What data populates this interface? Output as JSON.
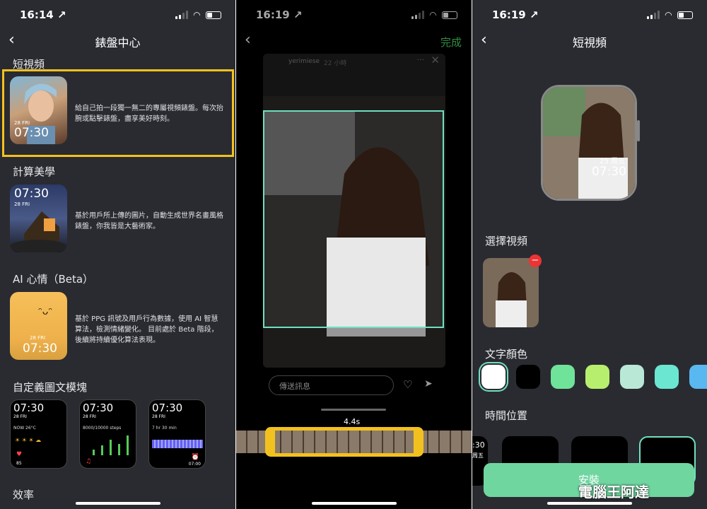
{
  "panel1": {
    "status_time": "16:14 ↗",
    "title": "錶盤中心",
    "sections": [
      {
        "title": "短視頻",
        "desc": "給自己拍一段獨一無二的專屬視頻錶盤。每次抬腕或點擊錶盤，盡享美好時刻。",
        "time": "07:30",
        "date": "28 FRI"
      },
      {
        "title": "計算美學",
        "desc": "基於用戶所上傳的圖片，自動生成世界名畫風格錶盤，你我皆是大藝術家。",
        "time": "07:30",
        "date": "28 FRI"
      },
      {
        "title": "AI 心情（Beta）",
        "desc": "基於 PPG 訊號及用戶行為數據，使用 AI 智慧算法，檢測情緒變化。 目前處於 Beta 階段，後續將持續優化算法表現。",
        "time": "07:30",
        "date": "28 FRI"
      }
    ],
    "custom_title": "自定義圖文模塊",
    "minis": [
      {
        "time": "07:30",
        "date": "28 FRI",
        "sub": "NOW 26°C",
        "footer": "85"
      },
      {
        "time": "07:30",
        "date": "28 FRI",
        "sub": "8000/10000 steps",
        "footer": ""
      },
      {
        "time": "07:30",
        "date": "28 FRI",
        "sub": "7 hr 30 min",
        "footer": "07:00"
      }
    ],
    "efficiency_title": "效率"
  },
  "panel2": {
    "status_time": "16:19 ↗",
    "done_label": "完成",
    "username": "yerimiese",
    "time_ago": "22 小時",
    "message_placeholder": "傳送訊息",
    "duration": "4.4s"
  },
  "panel3": {
    "status_time": "16:19 ↗",
    "title": "短視頻",
    "watch_date": "25 周五",
    "watch_time": "07:30",
    "select_video": "選擇視頻",
    "text_color": "文字顏色",
    "time_position": "時間位置",
    "tpos_time": ":30",
    "tpos_day": "周五",
    "install_label": "安裝",
    "watermark": "電腦王阿達"
  },
  "colors": {
    "accent_yellow": "#f3c11f",
    "install_green": "#6fd6a0",
    "done_green": "#4cd964",
    "swatches": [
      "#ffffff",
      "#000000",
      "#6fe39a",
      "#b8ee6e",
      "#b9e8d7",
      "#6be6d0",
      "#5ab8f0"
    ]
  }
}
